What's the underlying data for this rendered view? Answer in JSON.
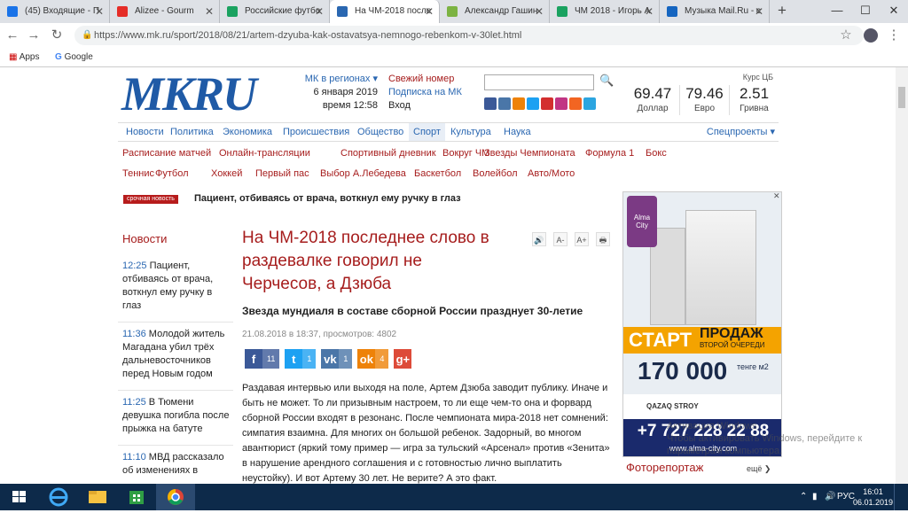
{
  "browser": {
    "tabs": [
      {
        "label": "(45) Входящие - П",
        "color": "#1a73e8"
      },
      {
        "label": "Alizee - Gourm",
        "color": "#e52d27"
      },
      {
        "label": "Российские футбо",
        "color": "#1aa260"
      },
      {
        "label": "На ЧМ-2018 после",
        "color": "#2a67b1",
        "active": true
      },
      {
        "label": "Александр Гашин",
        "color": "#7cb342"
      },
      {
        "label": "ЧМ 2018 - Игорь А",
        "color": "#1aa260"
      },
      {
        "label": "Музыка Mail.Ru - с",
        "color": "#1565c0"
      }
    ],
    "new_tab": "+",
    "minimize": "—",
    "maximize": "☐",
    "close": "✕",
    "url": "https://www.mk.ru/sport/2018/08/21/artem-dzyuba-kak-ostavatsya-nemnogo-rebenkom-v-30let.html",
    "bookmarks": [
      "Apps",
      "Google"
    ]
  },
  "site": {
    "logo": "MKRU",
    "regions": {
      "label": "МК в регионах ▾",
      "date": "6 января 2019",
      "time": "время 12:58"
    },
    "fresh": {
      "issue": "Свежий номер",
      "subscribe": "Подписка на МК",
      "login": "Вход"
    },
    "search": {
      "placeholder": ""
    },
    "social_colors": [
      "#3b5998",
      "#4a76a8",
      "#ee8208",
      "#1da1f2",
      "#d32f2f",
      "#c13584",
      "#f26522",
      "#2ca5e0"
    ],
    "rates": {
      "caption": "Курс ЦБ",
      "items": [
        {
          "value": "69.47",
          "label": "Доллар"
        },
        {
          "value": "79.46",
          "label": "Евро"
        },
        {
          "value": "2.51",
          "label": "Гривна"
        }
      ]
    },
    "nav": [
      "Новости",
      "Политика",
      "Экономика",
      "Происшествия",
      "Общество",
      "Спорт",
      "Культура",
      "Наука"
    ],
    "nav_active": "Спорт",
    "specprojects": "Спецпроекты ▾",
    "subnav1": [
      "Расписание матчей",
      "Онлайн-трансляции",
      "Спортивный дневник",
      "Вокруг ЧМ",
      "Звезды Чемпионата",
      "Формула 1",
      "Бокс"
    ],
    "subnav2": [
      "Теннис",
      "Футбол",
      "Хоккей",
      "Первый пас",
      "Выбор А.Лебедева",
      "Баскетбол",
      "Волейбол",
      "Авто/Мото"
    ],
    "breaking": {
      "badge": "срочная новость",
      "text": "Пациент, отбиваясь от врача, воткнул ему ручку в глаз"
    }
  },
  "news": {
    "heading": "Новости",
    "items": [
      {
        "time": "12:25",
        "text": "Пациент, отбиваясь от врача, воткнул ему ручку в глаз"
      },
      {
        "time": "11:36",
        "text": "Молодой житель Магадана убил трёх дальневосточников перед Новым годом"
      },
      {
        "time": "11:25",
        "text": "В Тюмени девушка погибла после прыжка на батуте"
      },
      {
        "time": "11:10",
        "text": "МВД рассказало об изменениях в"
      }
    ]
  },
  "article": {
    "headline": "На ЧМ-2018 последнее слово в раздевалке говорил не Черчесов, а Дзюба",
    "subtitle": "Звезда мундиаля в составе сборной России празднует 30-летие",
    "meta": "21.08.2018 в 18:37, просмотров: 4802",
    "tools": [
      "🔊",
      "A-",
      "A+",
      "🖶"
    ],
    "share": [
      {
        "icon": "f",
        "count": "11",
        "color": "#3b5998"
      },
      {
        "icon": "t",
        "count": "1",
        "color": "#1da1f2"
      },
      {
        "icon": "vk",
        "count": "1",
        "color": "#4a76a8"
      },
      {
        "icon": "ok",
        "count": "4",
        "color": "#ee8208"
      },
      {
        "icon": "g+",
        "count": "",
        "color": "#dd4b39"
      }
    ],
    "body": "Раздавая интервью или выходя на поле, Артем Дзюба заводит публику. Иначе и быть не может. То ли призывным настроем, то ли еще чем-то она и форвард сборной России входят в резонанс. После чемпионата мира-2018 нет сомнений: симпатия взаимна. Для многих он большой ребенок. Задорный, во многом авантюрист (яркий тому пример — игра за тульский «Арсенал» против «Зенита» в нарушение арендного соглашения и с готовностью лично выплатить неустойку). И вот Артему 30 лет. Не верите? А это факт."
  },
  "ad": {
    "brand": "Alma City",
    "start": "СТАРТ",
    "sales": "ПРОДАЖ",
    "queue": "ВТОРОЙ ОЧЕРЕДИ",
    "price": "170 000",
    "currency": "тенге м2",
    "partner": "QAZAQ STROY",
    "phone": "+7 727 228 22 88",
    "site": "www.alma-city.com"
  },
  "sidebar": {
    "photo": "Фоторепортаж",
    "more": "ещё ❯"
  },
  "watermark": "Активация Windows\nЧтобы активировать Windows, перейдите к параметрам компьютера.",
  "taskbar": {
    "lang": "РУС",
    "time": "16:01",
    "date": "06.01.2019"
  }
}
